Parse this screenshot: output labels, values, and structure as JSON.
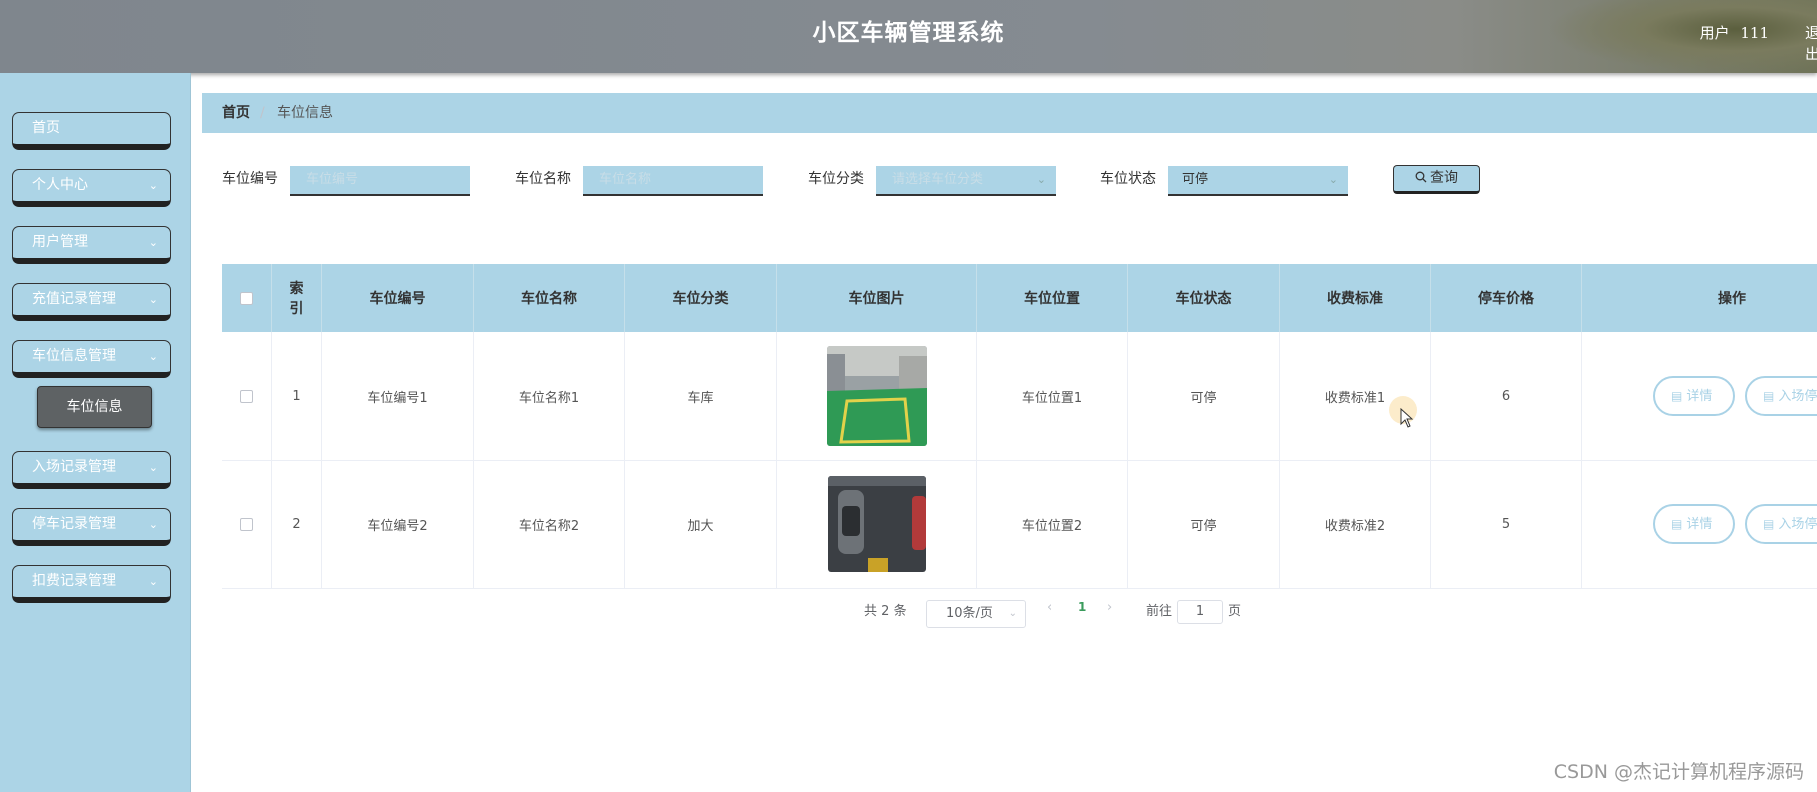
{
  "header": {
    "title": "小区车辆管理系统",
    "user_label": "用户",
    "user_name": "111",
    "logout_label": "退出"
  },
  "sidebar": {
    "items": [
      {
        "label": "首页"
      },
      {
        "label": "个人中心"
      },
      {
        "label": "用户管理"
      },
      {
        "label": "充值记录管理"
      },
      {
        "label": "车位信息管理"
      },
      {
        "label": "入场记录管理"
      },
      {
        "label": "停车记录管理"
      },
      {
        "label": "扣费记录管理"
      }
    ],
    "submenu": {
      "label": "车位信息"
    }
  },
  "breadcrumb": {
    "home": "首页",
    "separator": "/",
    "current": "车位信息"
  },
  "search": {
    "code_label": "车位编号",
    "code_placeholder": "车位编号",
    "name_label": "车位名称",
    "name_placeholder": "车位名称",
    "category_label": "车位分类",
    "category_placeholder": "请选择车位分类",
    "status_label": "车位状态",
    "status_value": "可停",
    "button_label": "查询"
  },
  "table": {
    "headers": [
      "索引",
      "车位编号",
      "车位名称",
      "车位分类",
      "车位图片",
      "车位位置",
      "车位状态",
      "收费标准",
      "停车价格",
      "操作"
    ],
    "rows": [
      {
        "index": "1",
        "code": "车位编号1",
        "name": "车位名称1",
        "category": "车库",
        "location": "车位位置1",
        "status": "可停",
        "fee": "收费标准1",
        "price": "6"
      },
      {
        "index": "2",
        "code": "车位编号2",
        "name": "车位名称2",
        "category": "加大",
        "location": "车位位置2",
        "status": "可停",
        "fee": "收费标准2",
        "price": "5"
      }
    ],
    "actions": {
      "detail": "详情",
      "enter": "入场停车"
    }
  },
  "pagination": {
    "total_prefix": "共",
    "total": "2",
    "total_suffix": "条",
    "page_size": "10条/页",
    "current_page": "1",
    "goto_prefix": "前往",
    "goto_value": "1",
    "goto_suffix": "页"
  },
  "watermark": "CSDN @杰记计算机程序源码"
}
